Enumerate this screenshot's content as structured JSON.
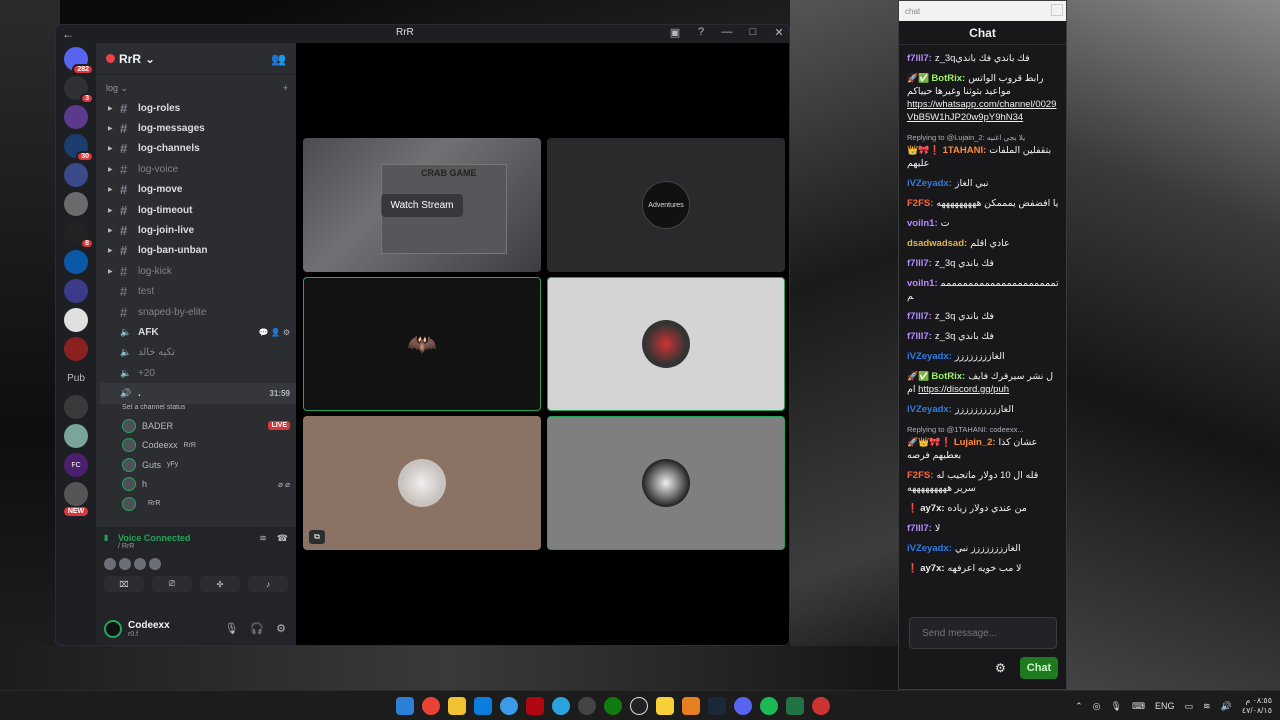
{
  "window": {
    "title": "RrR"
  },
  "guilds": [
    {
      "name": "discord-home",
      "badge": "282",
      "color": "#5865f2"
    },
    {
      "name": "guild-2",
      "badge": "3",
      "color": "#2f3136"
    },
    {
      "name": "guild-3",
      "badge": "",
      "color": "#5b3a8c"
    },
    {
      "name": "guild-4",
      "badge": "30",
      "color": "#1c3d6e"
    },
    {
      "name": "guild-5",
      "badge": "",
      "color": "#3b4a8a"
    },
    {
      "name": "guild-6",
      "badge": "",
      "color": "#6b6b6b"
    },
    {
      "name": "guild-7",
      "badge": "8",
      "color": "#222"
    },
    {
      "name": "guild-8",
      "badge": "",
      "color": "#0c58a8"
    },
    {
      "name": "guild-9",
      "badge": "",
      "color": "#3b3b8a"
    },
    {
      "name": "guild-10",
      "badge": "",
      "color": "#e0e0e0"
    },
    {
      "name": "guild-11",
      "badge": "",
      "color": "#8a2020"
    },
    {
      "name": "guild-12",
      "badge": "",
      "color": "#3a3a3a"
    },
    {
      "name": "guild-13",
      "badge": "",
      "color": "#7aa59a"
    },
    {
      "name": "guild-14",
      "badge": "",
      "color": "#4a1f6e"
    },
    {
      "name": "guild-15",
      "badge": "",
      "color": "#555"
    }
  ],
  "pub_label": "Pub",
  "new_label": "NEW",
  "fc_label": "FC",
  "server": {
    "name": "RrR"
  },
  "category": {
    "name": "log"
  },
  "channels": [
    {
      "name": "log-roles",
      "style": "bright",
      "arrow": true
    },
    {
      "name": "log-messages",
      "style": "bright",
      "arrow": true
    },
    {
      "name": "log-channels",
      "style": "bright",
      "arrow": true
    },
    {
      "name": "log-voice",
      "style": "dim",
      "arrow": true
    },
    {
      "name": "log-move",
      "style": "bright",
      "arrow": true
    },
    {
      "name": "log-timeout",
      "style": "bright",
      "arrow": true
    },
    {
      "name": "log-join-live",
      "style": "bright",
      "arrow": true
    },
    {
      "name": "log-ban-unban",
      "style": "bright",
      "arrow": true
    },
    {
      "name": "log-kick",
      "style": "dim",
      "arrow": true
    },
    {
      "name": "test",
      "style": "dim",
      "arrow": false
    },
    {
      "name": "snaped-by-elite",
      "style": "dim",
      "arrow": false
    }
  ],
  "voice_channels": [
    {
      "name": "AFK",
      "style": "bright"
    },
    {
      "name": "تكيه خالد",
      "style": "dim"
    },
    {
      "name": "+20",
      "style": "dim"
    }
  ],
  "active_vc": {
    "name": ".",
    "time": "31:59",
    "status": "Set a channel status"
  },
  "vc_users": [
    {
      "name": "BADER",
      "live": "LIVE",
      "tag": ""
    },
    {
      "name": "Codeexx",
      "live": "",
      "tag": "RrR"
    },
    {
      "name": "Guts",
      "live": "",
      "tag": "yFy"
    },
    {
      "name": "h",
      "live": "",
      "tag": ""
    },
    {
      "name": "",
      "live": "",
      "tag": "RrR"
    }
  ],
  "voice_panel": {
    "title": "Voice Connected",
    "sub": "/ RrR"
  },
  "user": {
    "name": "Codeexx",
    "status": "r0.f"
  },
  "stage": {
    "watch_label": "Watch Stream",
    "crab_text": "CRAB GAME",
    "avatar_text": "Adventures"
  },
  "chat": {
    "window_label": "chat",
    "title": "Chat",
    "placeholder": "Send message...",
    "send_label": "Chat",
    "messages": [
      {
        "name": "f7lll7:",
        "color": "#b48cff",
        "text": "z_3qفك باندي فك باندي",
        "icons": "",
        "reply": "",
        "link": ""
      },
      {
        "name": "BotRix:",
        "color": "#9cf26a",
        "text": "رابط قروب الواتس مواعيد بثوثنا وغيرها حيياكم",
        "icons": "🚀✅",
        "reply": "",
        "link": "https://whatsapp.com/channel/0029VbB5W1hJP20w9pY9hN34"
      },
      {
        "name": "1TAHANI:",
        "color": "#ff8c3a",
        "text": "بتقفلين الملفات عليهم",
        "icons": "👑🎀❗",
        "reply": "Replying to @Lujain_2: يلا يجي اغنيه",
        "link": ""
      },
      {
        "name": "iVZeyadx:",
        "color": "#2e7de0",
        "text": "نبي الغاز",
        "icons": "",
        "reply": "",
        "link": ""
      },
      {
        "name": "F2FS:",
        "color": "#ff6a3d",
        "text": "يا افضفض يمممكن هههههههههه",
        "icons": "",
        "reply": "",
        "link": ""
      },
      {
        "name": "voiln1:",
        "color": "#b48cff",
        "text": "ت",
        "icons": "",
        "reply": "",
        "link": ""
      },
      {
        "name": "dsadwadsad:",
        "color": "#e0b34a",
        "text": "عادي اقلم",
        "icons": "",
        "reply": "",
        "link": ""
      },
      {
        "name": "f7lll7:",
        "color": "#b48cff",
        "text": "z_3q فك باندي",
        "icons": "",
        "reply": "",
        "link": ""
      },
      {
        "name": "voiln1:",
        "color": "#b48cff",
        "text": "تمممممممممممممممممممممم",
        "icons": "",
        "reply": "",
        "link": ""
      },
      {
        "name": "f7lll7:",
        "color": "#b48cff",
        "text": "z_3q فك باندي",
        "icons": "",
        "reply": "",
        "link": ""
      },
      {
        "name": "f7lll7:",
        "color": "#b48cff",
        "text": "z_3q فك باندي",
        "icons": "",
        "reply": "",
        "link": ""
      },
      {
        "name": "iVZeyadx:",
        "color": "#2e7de0",
        "text": "الغازززززززز",
        "icons": "",
        "reply": "",
        "link": ""
      },
      {
        "name": "BotRix:",
        "color": "#9cf26a",
        "text": "ل نشر سيرفرك فايف ام",
        "icons": "🚀✅",
        "reply": "",
        "link": "https://discord.gg/puh"
      },
      {
        "name": "iVZeyadx:",
        "color": "#2e7de0",
        "text": "الغازززززززززز",
        "icons": "",
        "reply": "",
        "link": ""
      },
      {
        "name": "Lujain_2:",
        "color": "#ff8c3a",
        "text": "عشان كذا بعطيهم فرصه",
        "icons": "🚀👑🎀❗",
        "reply": "Replying to @1TAHANI: codeexx...",
        "link": ""
      },
      {
        "name": "F2FS:",
        "color": "#ff6a3d",
        "text": "قله ال 10 دولار ماتجيب له سرير هههههههههه",
        "icons": "",
        "reply": "",
        "link": ""
      },
      {
        "name": "ay7x:",
        "color": "#efeff1",
        "text": "من عندي دولار زياده",
        "icons": "❗",
        "reply": "",
        "link": ""
      },
      {
        "name": "f7lll7:",
        "color": "#b48cff",
        "text": "لا",
        "icons": "",
        "reply": "",
        "link": ""
      },
      {
        "name": "iVZeyadx:",
        "color": "#2e7de0",
        "text": "الغازززززززز نبي",
        "icons": "",
        "reply": "",
        "link": ""
      },
      {
        "name": "ay7x:",
        "color": "#efeff1",
        "text": "لا مب خويه اعرفهه",
        "icons": "❗",
        "reply": "",
        "link": ""
      }
    ]
  },
  "taskbar": {
    "lang": "ENG",
    "time": "٠٨:٥٥ م",
    "date": "٤٧/٠٨/١٥"
  }
}
